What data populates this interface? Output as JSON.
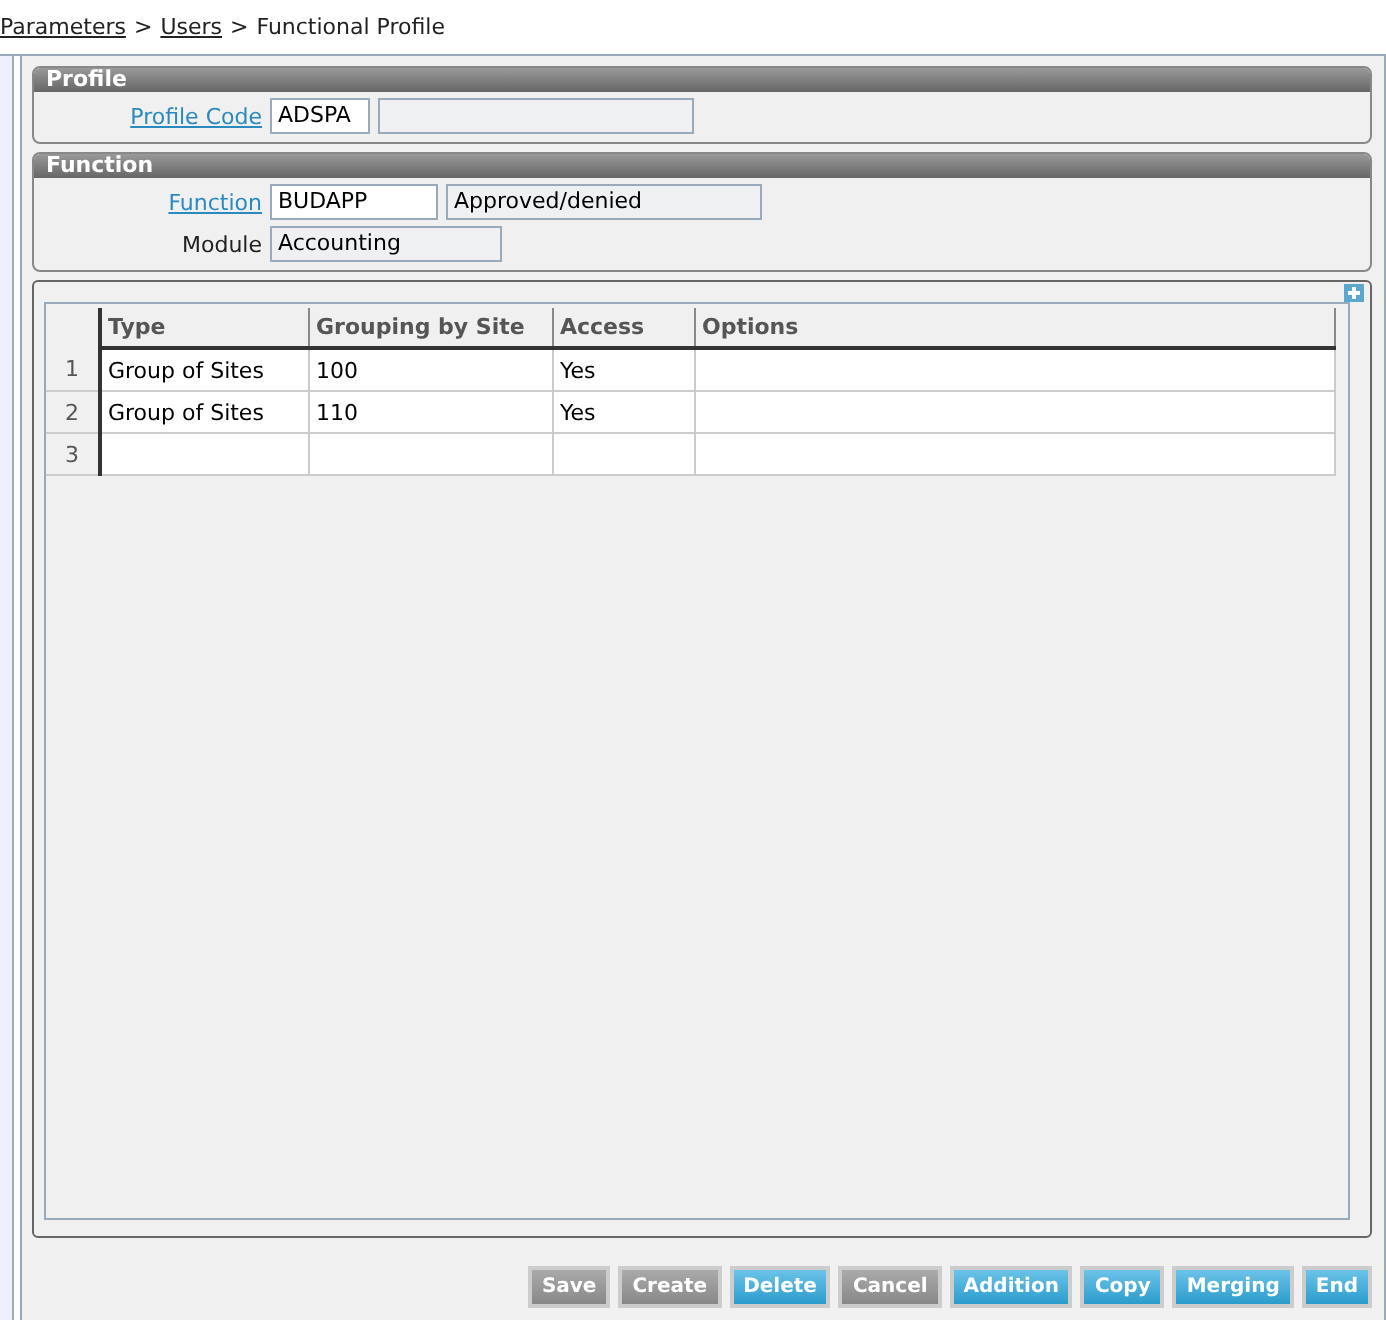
{
  "breadcrumb": [
    {
      "label": "Parameters",
      "link": true,
      "separator": ">"
    },
    {
      "label": "Users",
      "link": true,
      "separator": ">"
    },
    {
      "label": "Functional Profile",
      "link": false
    }
  ],
  "profile": {
    "title": "Profile",
    "code_label": "Profile Code",
    "code": "ADSPA"
  },
  "function": {
    "title": "Function",
    "function_label": "Function",
    "function_code": "BUDAPP",
    "function_description": "Approved/denied",
    "module_label": "Module",
    "module": "Accounting"
  },
  "table": {
    "columns": [
      "Type",
      "Grouping by Site",
      "Access",
      "Options"
    ],
    "rows": [
      {
        "number": "1",
        "cells": [
          "Group of Sites",
          "100",
          "Yes",
          ""
        ]
      },
      {
        "number": "2",
        "cells": [
          "Group of Sites",
          "110",
          "Yes",
          ""
        ]
      },
      {
        "number": "3",
        "cells": [
          "",
          "",
          "",
          ""
        ]
      }
    ]
  },
  "buttons": [
    {
      "label": "Save",
      "disabled": true
    },
    {
      "label": "Create",
      "disabled": true
    },
    {
      "label": "Delete",
      "disabled": false
    },
    {
      "label": "Cancel",
      "disabled": true
    },
    {
      "label": "Addition",
      "disabled": false
    },
    {
      "label": "Copy",
      "disabled": false
    },
    {
      "label": "Merging",
      "disabled": false
    },
    {
      "label": "End",
      "disabled": false
    }
  ]
}
